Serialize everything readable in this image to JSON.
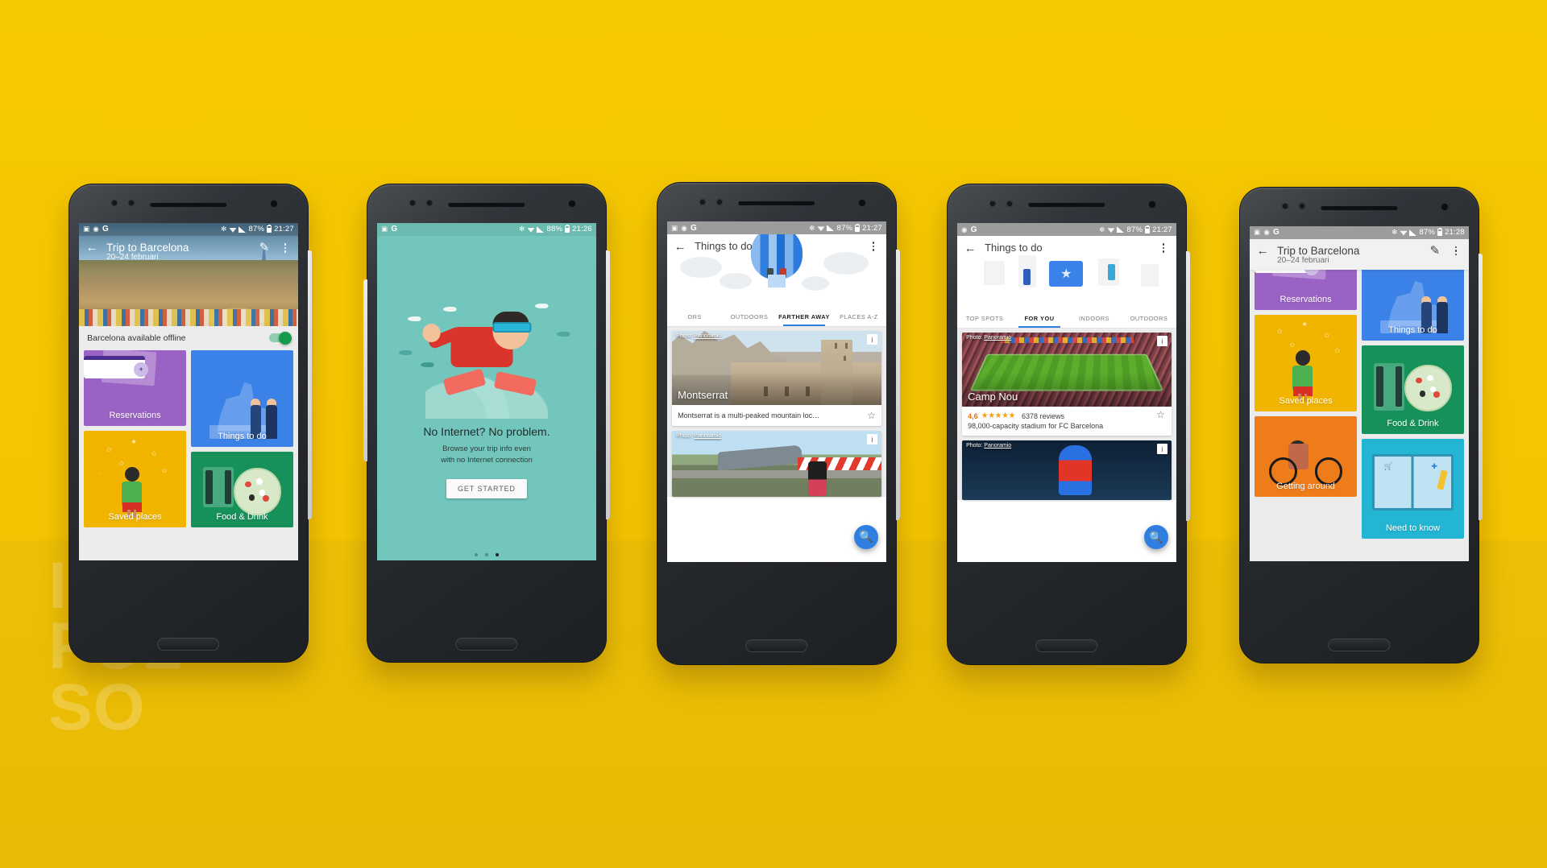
{
  "page": {
    "background_color": "#f5c400",
    "watermark": [
      "IM",
      "PUL",
      "SO"
    ]
  },
  "phones": [
    {
      "id": "phone-trip-offline",
      "status_bar": {
        "left_icons": [
          "image-icon",
          "sync-icon",
          "google-g-icon"
        ],
        "battery": "87%",
        "time": "21:27",
        "right_icons": [
          "bluetooth-icon",
          "wifi-icon",
          "signal-icon",
          "battery-icon"
        ]
      },
      "appbar": {
        "back": "←",
        "title": "Trip to Barcelona",
        "subtitle": "20–24 februari",
        "edit": "edit-icon",
        "overflow": "more-vert-icon"
      },
      "offline_row": {
        "label": "Barcelona available offline",
        "toggle_on": true
      },
      "tiles": [
        {
          "label": "Reservations",
          "color": "#9a62c4",
          "art": "tickets"
        },
        {
          "label": "Things to do",
          "color": "#3b82e8",
          "art": "statue-selfie"
        },
        {
          "label": "Saved places",
          "color": "#f1b500",
          "art": "girl-stars"
        },
        {
          "label": "Food & Drink",
          "color": "#17915a",
          "art": "plate-cutlery"
        }
      ]
    },
    {
      "id": "phone-no-internet",
      "status_bar": {
        "left_icons": [
          "image-icon",
          "google-g-icon"
        ],
        "battery": "88%",
        "time": "21:26",
        "right_icons": [
          "bluetooth-icon",
          "wifi-icon",
          "signal-icon",
          "battery-icon"
        ]
      },
      "headline": "No Internet? No problem.",
      "body_lines": [
        "Browse your trip info even",
        "with no Internet connection"
      ],
      "button": "GET STARTED",
      "pager": {
        "count": 3,
        "active_index": 2
      },
      "background_color": "#72c6bc"
    },
    {
      "id": "phone-things-to-do-farther",
      "status_bar": {
        "left_icons": [
          "image-icon",
          "sync-icon",
          "google-g-icon"
        ],
        "battery": "87%",
        "time": "21:27",
        "right_icons": [
          "bluetooth-icon",
          "wifi-icon",
          "signal-icon",
          "battery-icon"
        ]
      },
      "appbar": {
        "back": "←",
        "title": "Things to do",
        "overflow": "more-vert-icon"
      },
      "tabs": [
        {
          "label": "ORS",
          "active": false
        },
        {
          "label": "OUTDOORS",
          "active": false
        },
        {
          "label": "FARTHER AWAY",
          "active": true
        },
        {
          "label": "PLACES A-Z",
          "active": false
        }
      ],
      "cards": [
        {
          "credit_prefix": "Photo: ",
          "credit_link": "Panoramio",
          "name": "Montserrat",
          "description": "Montserrat is a multi-peaked mountain loc…",
          "save_icon": "star-outline-icon",
          "info_icon": "info-icon"
        },
        {
          "credit_prefix": "Photo: ",
          "credit_link": "Panoramio",
          "name": "",
          "description": "",
          "info_icon": "info-icon"
        }
      ],
      "fab": "search-icon"
    },
    {
      "id": "phone-things-to-do-foryou",
      "status_bar": {
        "left_icons": [
          "sync-icon",
          "google-g-icon"
        ],
        "battery": "87%",
        "time": "21:27",
        "right_icons": [
          "bluetooth-icon",
          "wifi-icon",
          "signal-icon",
          "battery-icon"
        ]
      },
      "appbar": {
        "back": "←",
        "title": "Things to do",
        "overflow": "more-vert-icon"
      },
      "tabs": [
        {
          "label": "TOP SPOTS",
          "active": false
        },
        {
          "label": "FOR YOU",
          "active": true
        },
        {
          "label": "INDOORS",
          "active": false
        },
        {
          "label": "OUTDOORS",
          "active": false
        }
      ],
      "cards": [
        {
          "credit_prefix": "Photo: ",
          "credit_link": "Panoramio",
          "name": "Camp Nou",
          "rating": "4,6",
          "stars": "★★★★★",
          "reviews": "6378 reviews",
          "description": "98,000-capacity stadium for FC Barcelona",
          "save_icon": "star-outline-icon",
          "info_icon": "info-icon"
        },
        {
          "credit_prefix": "Photo: ",
          "credit_link": "Panoramio",
          "name": "",
          "info_icon": "info-icon"
        }
      ],
      "fab": "search-icon"
    },
    {
      "id": "phone-trip-tiles",
      "status_bar": {
        "left_icons": [
          "image-icon",
          "sync-icon",
          "google-g-icon"
        ],
        "battery": "87%",
        "time": "21:28",
        "right_icons": [
          "bluetooth-icon",
          "wifi-icon",
          "signal-icon",
          "battery-icon"
        ]
      },
      "appbar": {
        "back": "←",
        "title": "Trip to Barcelona",
        "subtitle": "20–24 februari",
        "edit": "edit-icon",
        "overflow": "more-vert-icon"
      },
      "tiles": [
        {
          "label": "Reservations",
          "color": "#9a62c4",
          "art": "tickets"
        },
        {
          "label": "Things to do",
          "color": "#3b82e8",
          "art": "statue-selfie"
        },
        {
          "label": "Saved places",
          "color": "#f1b500",
          "art": "girl-stars"
        },
        {
          "label": "Food & Drink",
          "color": "#17915a",
          "art": "plate-cutlery"
        },
        {
          "label": "Getting around",
          "color": "#ef7c1b",
          "art": "bicycle"
        },
        {
          "label": "Need to know",
          "color": "#22b6d4",
          "art": "guidebook"
        }
      ]
    }
  ]
}
